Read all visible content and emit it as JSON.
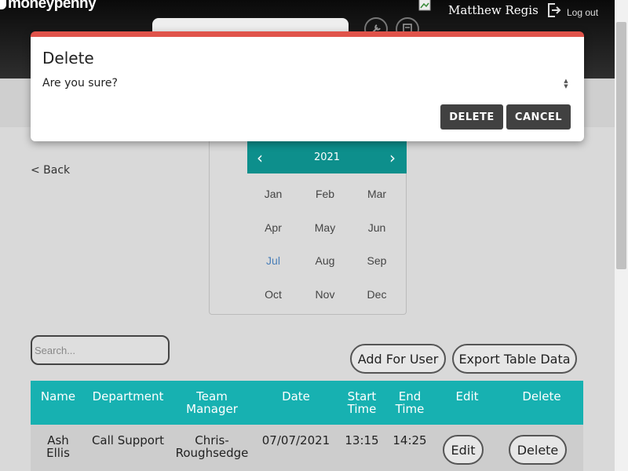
{
  "header": {
    "logo_text": "moneypenny",
    "user_name": "Matthew Regis",
    "logout_label": "Log out"
  },
  "modal": {
    "title": "Delete",
    "message": "Are you sure?",
    "delete_label": "DELETE",
    "cancel_label": "CANCEL",
    "accent_color": "#e0534a"
  },
  "back_label": "< Back",
  "calendar": {
    "year": "2021",
    "prev_icon": "chevron-left-icon",
    "next_icon": "chevron-right-icon",
    "months": [
      "Jan",
      "Feb",
      "Mar",
      "Apr",
      "May",
      "Jun",
      "Jul",
      "Aug",
      "Sep",
      "Oct",
      "Nov",
      "Dec"
    ],
    "selected_month": "Jul",
    "header_color": "#0d8f8c"
  },
  "search": {
    "placeholder": "Search..."
  },
  "actions": {
    "add_for_user": "Add For User",
    "export": "Export Table Data"
  },
  "table": {
    "header_color": "#17b1b1",
    "columns": [
      "Name",
      "Department",
      "Team Manager",
      "Date",
      "Start Time",
      "End Time",
      "Edit",
      "Delete"
    ],
    "rows": [
      {
        "name": "Ash Ellis",
        "department": "Call Support",
        "team_manager": "Chris-Roughsedge",
        "date": "07/07/2021",
        "start_time": "13:15",
        "end_time": "14:25",
        "edit_label": "Edit",
        "delete_label": "Delete"
      }
    ]
  }
}
